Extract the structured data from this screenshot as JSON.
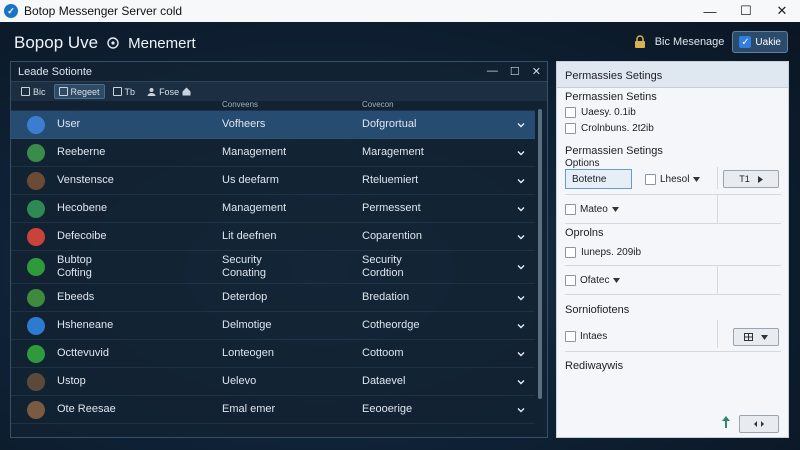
{
  "window": {
    "title": "Botop Messenger Server cold",
    "controls": [
      "—",
      "☐",
      "✕"
    ]
  },
  "header": {
    "app_title": "Bopop Uve",
    "app_subtitle": "Menemert",
    "link_label": "Bic Mesenage",
    "button_label": "Uakie"
  },
  "left_panel": {
    "title": "Leade Sotionte",
    "controls": [
      "—",
      "☐",
      "✕"
    ],
    "toolbar": [
      {
        "label": "Bic",
        "icon": "list-icon"
      },
      {
        "label": "Regeet",
        "icon": "grid-icon",
        "active": true
      },
      {
        "label": "Tb",
        "icon": "window-icon"
      },
      {
        "label": "Fose",
        "icon": "person-icon"
      }
    ],
    "partial_row": {
      "c2": "Conveens",
      "c3": "Covecon"
    },
    "rows": [
      {
        "c1": "User",
        "c2": "Vofheers",
        "c3": "Dofgrortual",
        "avatar_color": "#3b7ed1",
        "selected": true
      },
      {
        "c1": "Reeberne",
        "c2": "Management",
        "c3": "Maragement",
        "avatar_color": "#3a8c4a"
      },
      {
        "c1": "Venstensce",
        "c2": "Us deefarm",
        "c3": "Rteluemiert",
        "avatar_color": "#6b4a36"
      },
      {
        "c1": "Hecobene",
        "c2": "Management",
        "c3": "Permessent",
        "avatar_color": "#2e8a52"
      },
      {
        "c1": "Defecoibe",
        "c2": "Lit deefnen",
        "c3": "Coparention",
        "avatar_color": "#c9433a"
      },
      {
        "c1": "Bubtop\nCofting",
        "c2": "Security\nConating",
        "c3": "Security\nCordtion",
        "avatar_color": "#2f9a3c",
        "tall": true
      },
      {
        "c1": "Ebeeds",
        "c2": "Deterdop",
        "c3": "Bredation",
        "avatar_color": "#3e8a3f"
      },
      {
        "c1": "Hsheneane",
        "c2": "Delmotige",
        "c3": "Cotheordge",
        "avatar_color": "#2d7ad1"
      },
      {
        "c1": "Octtevuvid",
        "c2": "Lonteogen",
        "c3": "Cottoom",
        "avatar_color": "#2f9a3c"
      },
      {
        "c1": "Ustop",
        "c2": "Uelevo",
        "c3": "Dataevel",
        "avatar_color": "#5b4a3a"
      },
      {
        "c1": "Ote Reesae",
        "c2": "Emal emer",
        "c3": "Eeooerige",
        "avatar_color": "#7a5a40"
      }
    ]
  },
  "right_panel": {
    "header": "Permassies Setings",
    "section1_title": "Permassien Setins",
    "checkboxes1": [
      "Uaesy. 0.1ib",
      "Crolnbuns. 2t2ib"
    ],
    "section2_title": "Permassien Setings",
    "options_label": "Options",
    "input_value": "Botetne",
    "select1_label": "Lhesol",
    "button1_label": "T1",
    "select2_label": "Mateo",
    "section3_title": "Oprolns",
    "text3": "Iuneps. 209ib",
    "select3_label": "Ofatec",
    "section4_title": "Sorniofiotens",
    "select4_label": "Intaes",
    "section5_title": "Rediwaywis"
  }
}
